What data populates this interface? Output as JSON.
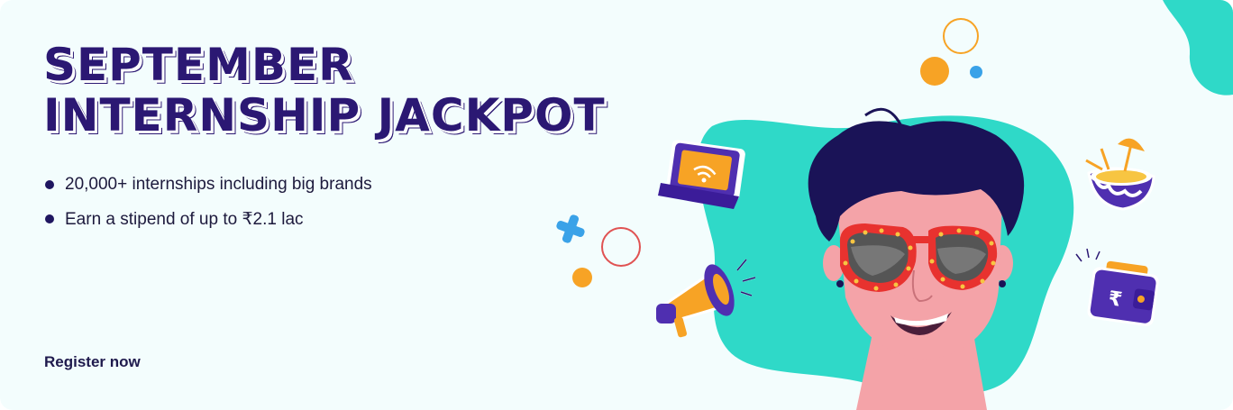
{
  "banner": {
    "title_line1": "SEPTEMBER",
    "title_line2": "INTERNSHIP JACKPOT",
    "bullets": [
      "20,000+ internships including big brands",
      "Earn a stipend of up to ₹2.1 lac"
    ],
    "cta_label": "Register now",
    "wallet_symbol": "₹"
  },
  "colors": {
    "background": "#f3fdfd",
    "accent_teal": "#2fd9c8",
    "title_purple": "#2b1873",
    "hair_navy": "#1a1357",
    "skin": "#f4a3a8",
    "glasses_red": "#e8322f",
    "orange": "#f7a325",
    "blue": "#3aa2e8"
  },
  "icons": [
    "laptop-wifi-icon",
    "megaphone-icon",
    "coconut-drink-icon",
    "wallet-icon",
    "plus-icon",
    "circle-decor"
  ]
}
